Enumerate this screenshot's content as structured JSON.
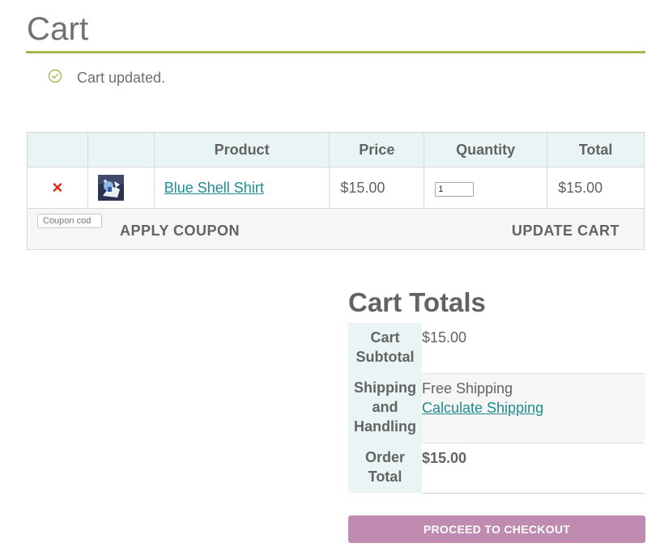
{
  "page": {
    "title": "Cart"
  },
  "notice": {
    "icon": "check-circle-icon",
    "text": "Cart updated.",
    "accent_color": "#a2b74d"
  },
  "cart_table": {
    "headers": [
      "",
      "",
      "Product",
      "Price",
      "Quantity",
      "Total"
    ],
    "items": [
      {
        "remove_icon": "remove-x-icon",
        "remove_glyph": "×",
        "thumbnail": "product-thumbnail",
        "product": "Blue Shell Shirt",
        "price": "$15.00",
        "quantity": "1",
        "total": "$15.00"
      }
    ],
    "coupon_placeholder": "Coupon cod",
    "apply_coupon_label": "APPLY COUPON",
    "update_cart_label": "UPDATE CART"
  },
  "cart_totals": {
    "title": "Cart Totals",
    "rows": [
      {
        "label": "Cart Subtotal",
        "value": "$15.00"
      },
      {
        "label": "Shipping and Handling",
        "value": "Free Shipping",
        "link": "Calculate Shipping"
      },
      {
        "label": "Order Total",
        "value": "$15.00"
      }
    ],
    "checkout_label": "PROCEED TO CHECKOUT"
  },
  "colors": {
    "link": "#1f8b91",
    "header_bg": "#e9f4f5",
    "remove": "#e2261e",
    "checkout_button": "#c08bb0"
  }
}
